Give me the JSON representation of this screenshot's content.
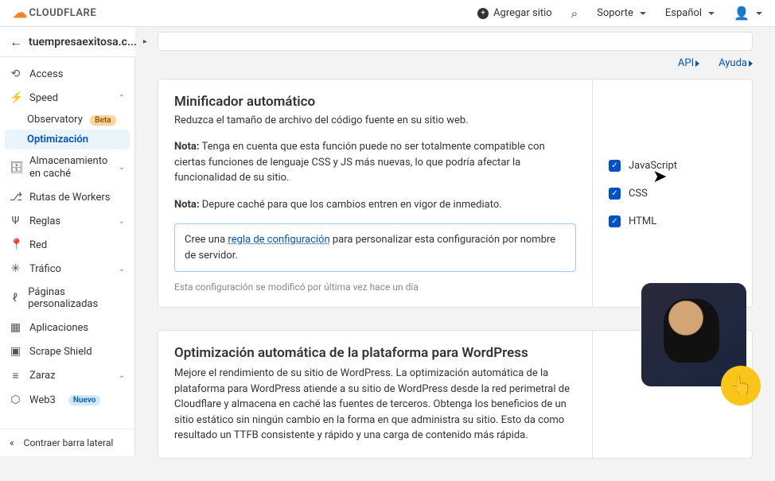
{
  "header": {
    "brand": "CLOUDFLARE",
    "add_site": "Agregar sitio",
    "support": "Soporte",
    "language": "Español"
  },
  "breadcrumb": {
    "site_truncated": "tuempresaexitosa.c..."
  },
  "sidebar": {
    "access": "Access",
    "speed": "Speed",
    "observatory": "Observatory",
    "observatory_badge": "Beta",
    "optimization": "Optimización",
    "cache": "Almacenamiento en caché",
    "workers_routes": "Rutas de Workers",
    "rules": "Reglas",
    "network": "Red",
    "traffic": "Tráfico",
    "custom_pages": "Páginas personalizadas",
    "apps": "Aplicaciones",
    "scrape_shield": "Scrape Shield",
    "zaraz": "Zaraz",
    "web3": "Web3",
    "web3_badge": "Nuevo",
    "collapse": "Contraer barra lateral"
  },
  "links": {
    "api": "API",
    "help": "Ayuda"
  },
  "minify_card": {
    "title": "Minificador automático",
    "subtitle": "Reduzca el tamaño de archivo del código fuente en su sitio web.",
    "note1_label": "Nota:",
    "note1_text": " Tenga en cuenta que esta función puede no ser totalmente compatible con ciertas funciones de lenguaje CSS y JS más nuevas, lo que podría afectar la funcionalidad de su sitio.",
    "note2_label": "Nota:",
    "note2_text": " Depure caché para que los cambios entren en vigor de inmediato.",
    "box_pre": "Cree una ",
    "box_link": "regla de configuración",
    "box_post": " para personalizar esta configuración por nombre de servidor.",
    "meta": "Esta configuración se modificó por última vez hace un día",
    "opt_js": "JavaScript",
    "opt_css": "CSS",
    "opt_html": "HTML"
  },
  "apo_card": {
    "title": "Optimización automática de la plataforma para WordPress",
    "body": "Mejore el rendimiento de su sitio de WordPress. La optimización automática de la plataforma para WordPress atiende a su sitio de WordPress desde la red perimetral de Cloudflare y almacena en caché las fuentes de terceros. Obtenga los beneficios de un sitio estático sin ningún cambio en la forma en que administra su sitio. Esto da como resultado un TTFB consistente y rápido y una carga de contenido más rápida."
  }
}
